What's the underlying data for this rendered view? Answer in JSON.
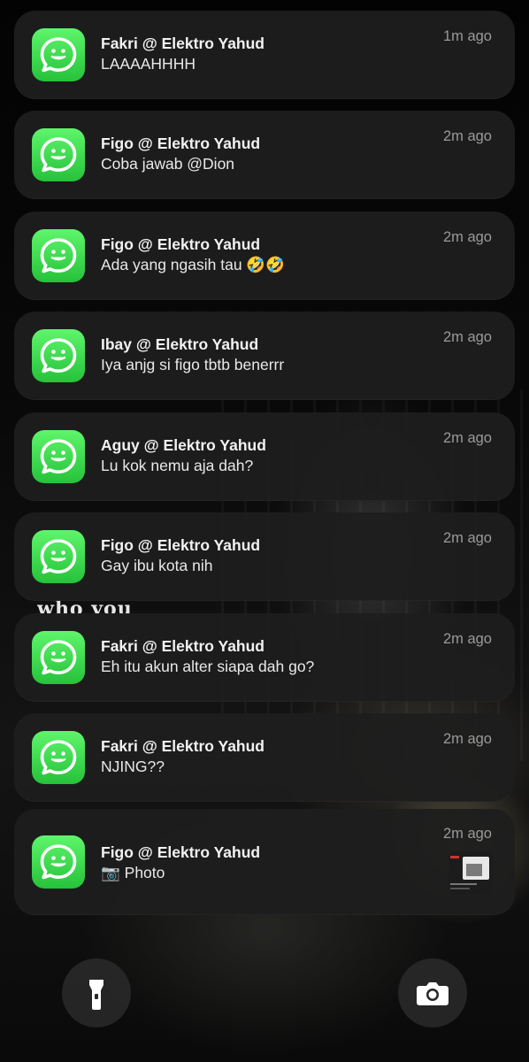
{
  "notifications": [
    {
      "title": "Fakri @ Elektro Yahud",
      "message": "LAAAAHHHH",
      "time": "1m ago",
      "has_thumbnail": false
    },
    {
      "title": "Figo @ Elektro Yahud",
      "message": "Coba jawab @Dion",
      "time": "2m ago",
      "has_thumbnail": false
    },
    {
      "title": "Figo @ Elektro Yahud",
      "message": "Ada yang ngasih tau 🤣🤣",
      "time": "2m ago",
      "has_thumbnail": false
    },
    {
      "title": "Ibay @ Elektro Yahud",
      "message": "Iya anjg si figo tbtb benerrr",
      "time": "2m ago",
      "has_thumbnail": false
    },
    {
      "title": "Aguy @ Elektro Yahud",
      "message": "Lu kok nemu aja dah?",
      "time": "2m ago",
      "has_thumbnail": false
    },
    {
      "title": "Figo @ Elektro Yahud",
      "message": "Gay ibu kota nih",
      "time": "2m ago",
      "has_thumbnail": false
    },
    {
      "title": "Fakri @ Elektro Yahud",
      "message": "Eh itu akun alter siapa dah go?",
      "time": "2m ago",
      "has_thumbnail": false
    },
    {
      "title": "Fakri @ Elektro Yahud",
      "message": "NJING??",
      "time": "2m ago",
      "has_thumbnail": false
    },
    {
      "title": "Figo @ Elektro Yahud",
      "message": "📷 Photo",
      "time": "2m ago",
      "has_thumbnail": true
    }
  ],
  "app_icon": "whatsapp-style-chat-icon",
  "wallpaper_caption": "who you",
  "controls": {
    "left_icon": "flashlight-icon",
    "right_icon": "camera-icon"
  },
  "colors": {
    "app_icon_green": "#2fcc45",
    "card_background": "#1e1e1e",
    "time_text": "#9a9a9a"
  }
}
